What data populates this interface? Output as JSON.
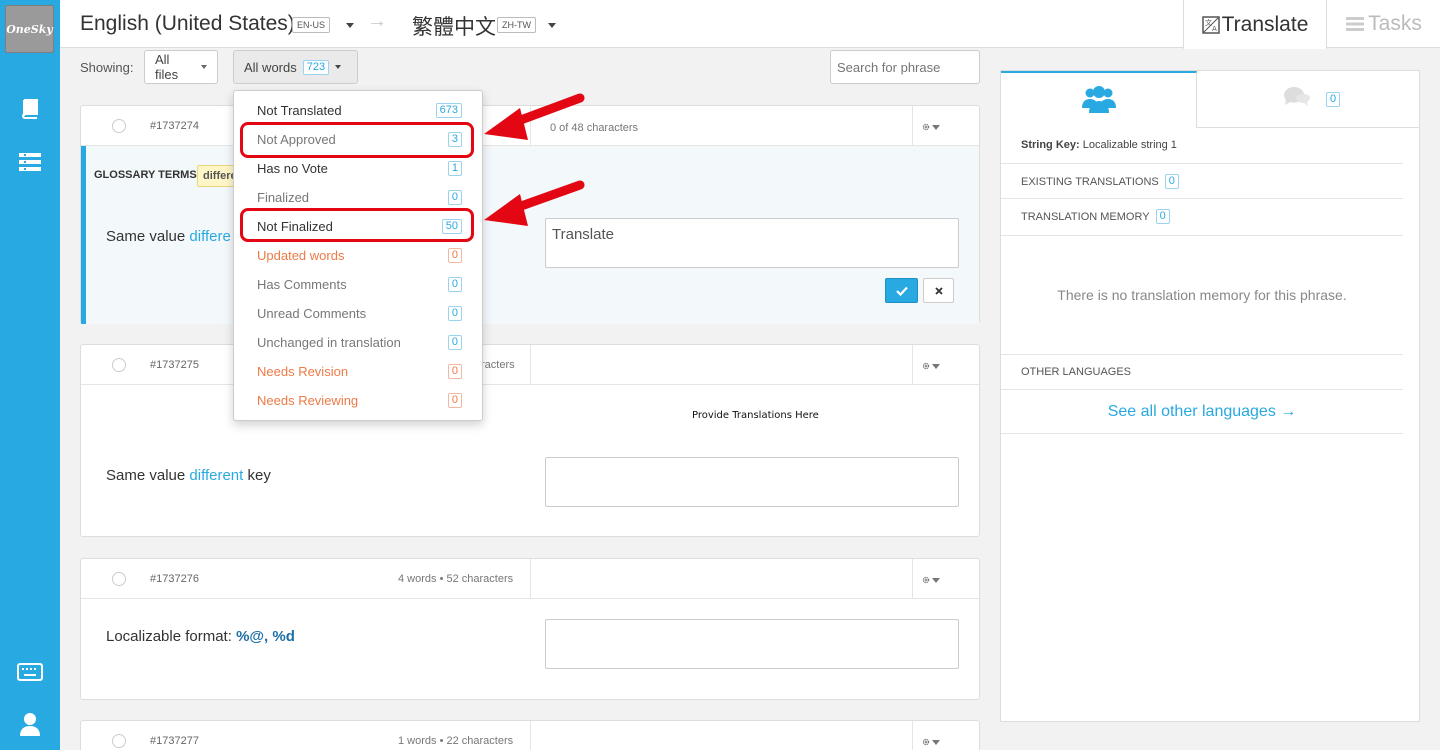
{
  "app": {
    "logo_text": "OneSky"
  },
  "sidebar": {
    "icons": [
      "book-icon",
      "list-icon",
      "keyboard-icon",
      "user-icon"
    ]
  },
  "header": {
    "source_lang": "English (United States)",
    "source_code": "EN-US",
    "arrow": "→",
    "target_lang": "繁體中文",
    "target_code": "ZH-TW",
    "tab_translate": "Translate",
    "tab_tasks": "Tasks"
  },
  "filters": {
    "showing_label": "Showing:",
    "files_label": "All files",
    "words_label": "All words",
    "words_count": "723",
    "search_placeholder": "Search for phrase"
  },
  "dropdown": {
    "items": [
      {
        "label": "Not Translated",
        "count": "673"
      },
      {
        "label": "Not Approved",
        "count": "3"
      },
      {
        "label": "Has no Vote",
        "count": "1"
      },
      {
        "label": "Finalized",
        "count": "0"
      },
      {
        "label": "Not Finalized",
        "count": "50"
      },
      {
        "label": "Updated words",
        "count": "0"
      },
      {
        "label": "Has Comments",
        "count": "0"
      },
      {
        "label": "Unread Comments",
        "count": "0"
      },
      {
        "label": "Unchanged in translation",
        "count": "0"
      },
      {
        "label": "Needs Revision",
        "count": "0"
      },
      {
        "label": "Needs Reviewing",
        "count": "0"
      }
    ]
  },
  "phrases": [
    {
      "id": "#1737274",
      "info": "0 of 48 characters",
      "glossary_label": "GLOSSARY TERMS",
      "glossary_term": "differe",
      "source_pre": "Same value ",
      "source_hl": "differe",
      "source_post": "",
      "translation_placeholder": "Translate"
    },
    {
      "id": "#1737275",
      "info": "racters",
      "hint": "Provide Translations Here",
      "source_pre": "Same value ",
      "source_hl": "different",
      "source_post": " key"
    },
    {
      "id": "#1737276",
      "info": "4 words • 52 characters",
      "source_pre": "Localizable format: ",
      "source_hl": "%@, %d",
      "source_post": ""
    },
    {
      "id": "#1737277",
      "info": "1 words • 22 characters"
    }
  ],
  "right_panel": {
    "comments_count": "0",
    "string_key_label": "String Key:",
    "string_key_value": "Localizable string 1",
    "existing_label": "EXISTING TRANSLATIONS",
    "existing_count": "0",
    "tm_label": "TRANSLATION MEMORY",
    "tm_count": "0",
    "tm_empty": "There is no translation memory for this phrase.",
    "other_label": "OTHER LANGUAGES",
    "see_all": "See all other languages →"
  },
  "colors": {
    "accent": "#29a9e1",
    "annotation_red": "#e30613",
    "orange": "#ee7a47"
  }
}
